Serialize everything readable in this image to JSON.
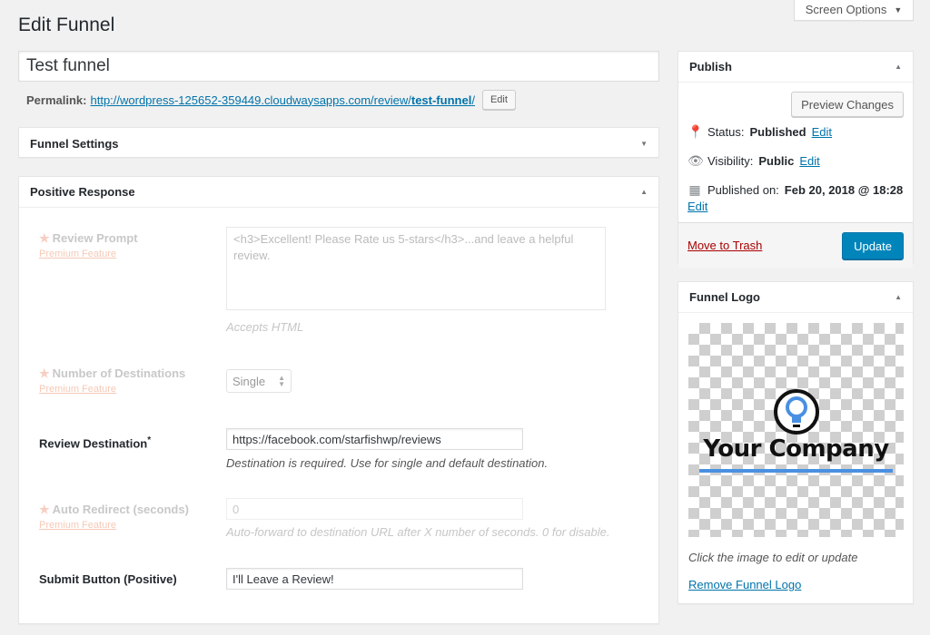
{
  "header": {
    "screen_options": "Screen Options",
    "title": "Edit Funnel"
  },
  "post": {
    "title": "Test funnel",
    "permalink_label": "Permalink:",
    "permalink_url": "http://wordpress-125652-359449.cloudwaysapps.com/review/",
    "permalink_slug": "test-funnel",
    "permalink_trailing": "/",
    "permalink_edit": "Edit"
  },
  "funnel_settings": {
    "title": "Funnel Settings"
  },
  "positive_response": {
    "title": "Positive Response",
    "premium_label": "Premium Feature",
    "review_prompt": {
      "label": "Review Prompt",
      "value": "<h3>Excellent! Please Rate us 5-stars</h3>...and leave a helpful review.",
      "hint": "Accepts HTML"
    },
    "num_destinations": {
      "label": "Number of Destinations",
      "selected": "Single"
    },
    "review_destination": {
      "label": "Review Destination",
      "required_mark": "*",
      "value": "https://facebook.com/starfishwp/reviews",
      "hint": "Destination is required. Use for single and default destination."
    },
    "auto_redirect": {
      "label": "Auto Redirect (seconds)",
      "value": "0",
      "hint": "Auto-forward to destination URL after X number of seconds. 0 for disable."
    },
    "submit_button": {
      "label": "Submit Button (Positive)",
      "value": "I'll Leave a Review!"
    }
  },
  "publish": {
    "title": "Publish",
    "preview_button": "Preview Changes",
    "status_label": "Status:",
    "status_value": "Published",
    "visibility_label": "Visibility:",
    "visibility_value": "Public",
    "published_label": "Published on:",
    "published_value": "Feb 20, 2018 @ 18:28",
    "edit_link": "Edit",
    "trash_link": "Move to Trash",
    "update_button": "Update",
    "colors": {
      "primary": "#0085ba",
      "trash": "#aa0000"
    }
  },
  "funnel_logo": {
    "title": "Funnel Logo",
    "logo_text": "Your Company",
    "caption": "Click the image to edit or update",
    "remove_link": "Remove Funnel Logo"
  }
}
